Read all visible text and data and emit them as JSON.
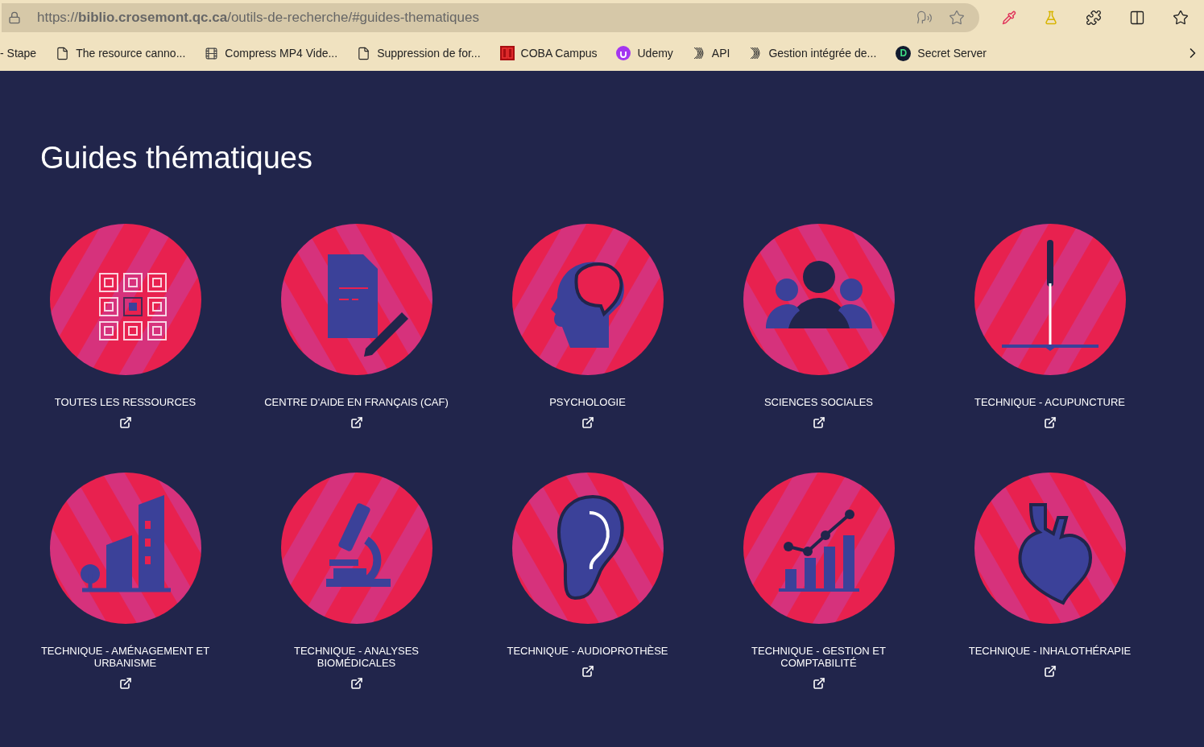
{
  "browser": {
    "url": "https://**biblio.crosemont.qc.ca**/outils-de-recherche/#guides-thematiques"
  },
  "bookmarks": [
    {
      "label": "- Stape",
      "kind": "none"
    },
    {
      "label": "The resource canno...",
      "kind": "page"
    },
    {
      "label": "Compress MP4 Vide...",
      "kind": "film"
    },
    {
      "label": "Suppression de for...",
      "kind": "page"
    },
    {
      "label": "COBA Campus",
      "kind": "coba"
    },
    {
      "label": "Udemy",
      "kind": "udemy"
    },
    {
      "label": "API",
      "kind": "swirl"
    },
    {
      "label": "Gestion intégrée de...",
      "kind": "swirl"
    },
    {
      "label": "Secret Server",
      "kind": "letter",
      "letter": "D"
    }
  ],
  "page": {
    "title": "Guides thématiques"
  },
  "guides": [
    {
      "title": "TOUTES LES RESSOURCES",
      "kind": "grid"
    },
    {
      "title": "CENTRE D'AIDE EN FRANÇAIS (CAF)",
      "kind": "document"
    },
    {
      "title": "PSYCHOLOGIE",
      "kind": "brain"
    },
    {
      "title": "SCIENCES SOCIALES",
      "kind": "people"
    },
    {
      "title": "TECHNIQUE - ACUPUNCTURE",
      "kind": "needle"
    },
    {
      "title": "TECHNIQUE - AMÉNAGEMENT ET URBANISME",
      "kind": "building"
    },
    {
      "title": "TECHNIQUE - ANALYSES BIOMÉDICALES",
      "kind": "microscope"
    },
    {
      "title": "TECHNIQUE - AUDIOPROTHÈSE",
      "kind": "ear"
    },
    {
      "title": "TECHNIQUE - GESTION ET COMPTABILITÉ",
      "kind": "chart"
    },
    {
      "title": "TECHNIQUE - INHALOTHÉRAPIE",
      "kind": "heart"
    }
  ]
}
